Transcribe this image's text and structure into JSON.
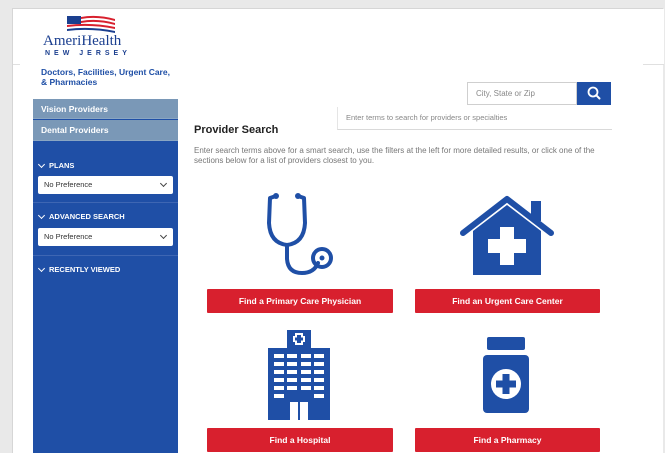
{
  "brand": {
    "name": "AmeriHealth",
    "region": "NEW JERSEY",
    "primary_color": "#1f4fa6",
    "accent_color": "#d8202e"
  },
  "sidebar": {
    "top_link": "Doctors, Facilities, Urgent Care, & Pharmacies",
    "items": [
      {
        "label": "Vision Providers"
      },
      {
        "label": "Dental Providers"
      }
    ],
    "plans": {
      "label": "PLANS",
      "value": "No Preference"
    },
    "advanced": {
      "label": "ADVANCED SEARCH",
      "value": "No Preference"
    },
    "recent": {
      "label": "RECENTLY VIEWED"
    }
  },
  "search": {
    "location_placeholder": "City, State or Zip",
    "terms_placeholder": "Enter terms to search for providers or specialties",
    "button_icon": "search-icon"
  },
  "main": {
    "title": "Provider Search",
    "intro": "Enter search terms above for a smart search, use the filters at the left for more detailed results, or click one of the sections below for a list of providers closest to you.",
    "cards": [
      {
        "label": "Find a Primary Care Physician",
        "icon": "stethoscope-icon"
      },
      {
        "label": "Find an Urgent Care Center",
        "icon": "house-medical-icon"
      },
      {
        "label": "Find a Hospital",
        "icon": "hospital-building-icon"
      },
      {
        "label": "Find a Pharmacy",
        "icon": "medicine-bottle-icon"
      }
    ]
  }
}
